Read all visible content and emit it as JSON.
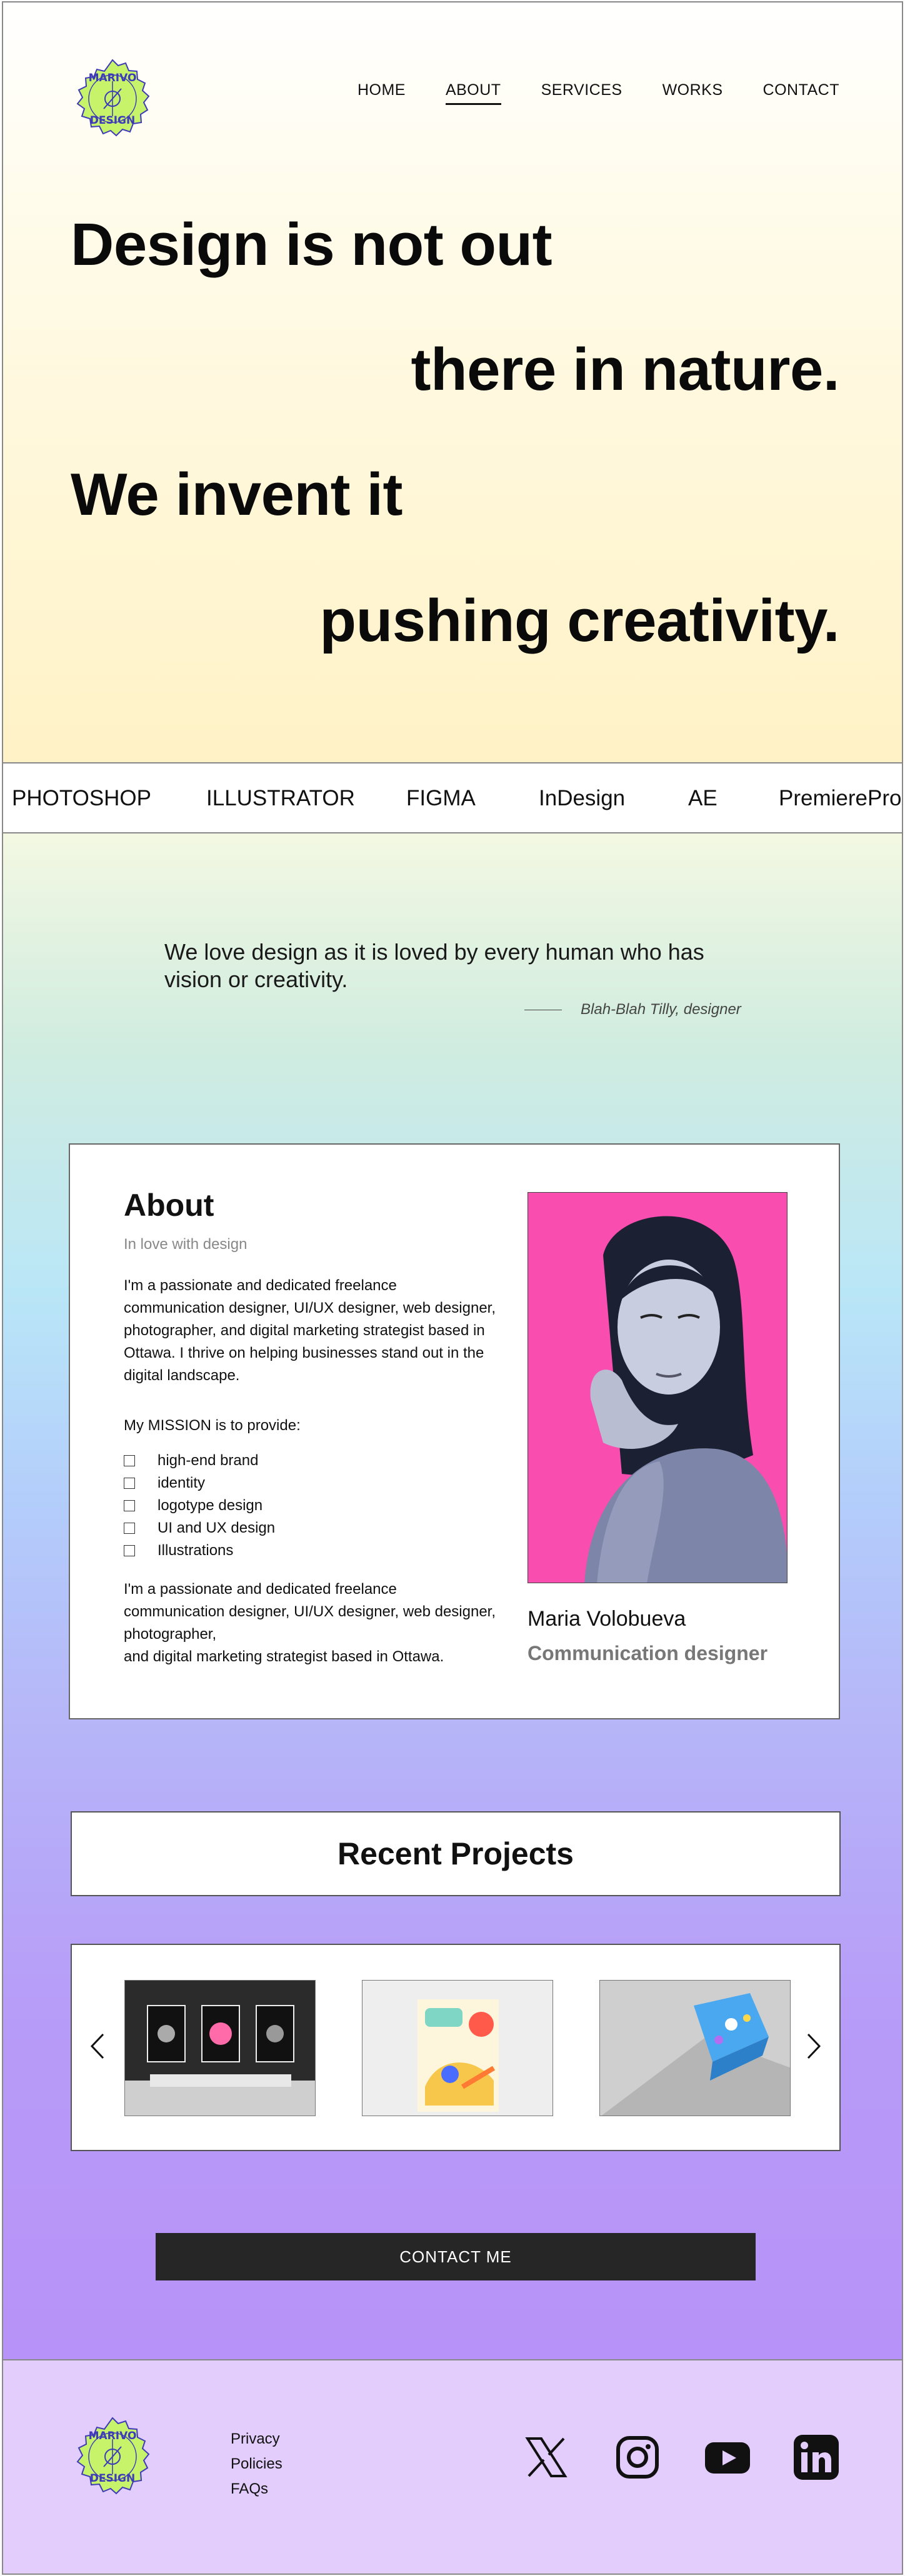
{
  "brand": {
    "logo_alt": "Marivo Design logo",
    "logo_text_top": "MARIVO",
    "logo_text_bottom": "DESIGN",
    "logo_color": "#c7f36b"
  },
  "nav": {
    "items": [
      {
        "label": "HOME",
        "active": false
      },
      {
        "label": "ABOUT",
        "active": true
      },
      {
        "label": "SERVICES",
        "active": false
      },
      {
        "label": "WORKS",
        "active": false
      },
      {
        "label": "CONTACT",
        "active": false
      }
    ]
  },
  "hero": {
    "lines": [
      "Design is not out",
      "there in nature.",
      "We invent it",
      "pushing creativity."
    ]
  },
  "tools": [
    "PHOTOSHOP",
    "ILLUSTRATOR",
    "FIGMA",
    "InDesign",
    "AE",
    "PremierePro"
  ],
  "quote": {
    "text": "We love design as it is loved by every human who has vision or creativity.",
    "author": "Blah-Blah Tilly, designer"
  },
  "about": {
    "title": "About",
    "subtitle": "In love with design",
    "intro": "I'm a passionate and dedicated freelance communication designer, UI/UX designer, web designer, photographer, and digital marketing strategist based in Ottawa. I thrive on helping businesses stand out in the digital landscape.",
    "mission_heading": "My MISSION is to provide:",
    "mission_items": [
      "high-end brand",
      "identity",
      "logotype design",
      "UI and UX design",
      "Illustrations"
    ],
    "outro": "I'm a passionate and dedicated freelance communication designer, UI/UX designer, web designer, photographer,\nand digital marketing strategist based in Ottawa.",
    "person_name": "Maria Volobueva",
    "person_role": "Communication designer",
    "photo_bg": "#f94db0"
  },
  "projects": {
    "title": "Recent Projects",
    "thumbnails": [
      "gallery-posters-thumbnail",
      "illustrated-poster-thumbnail",
      "blue-package-thumbnail"
    ]
  },
  "cta": {
    "label": "CONTACT ME"
  },
  "footer": {
    "links": [
      "Privacy",
      "Policies",
      "FAQs"
    ],
    "social": [
      "x-icon",
      "instagram-icon",
      "youtube-icon",
      "linkedin-icon"
    ]
  }
}
